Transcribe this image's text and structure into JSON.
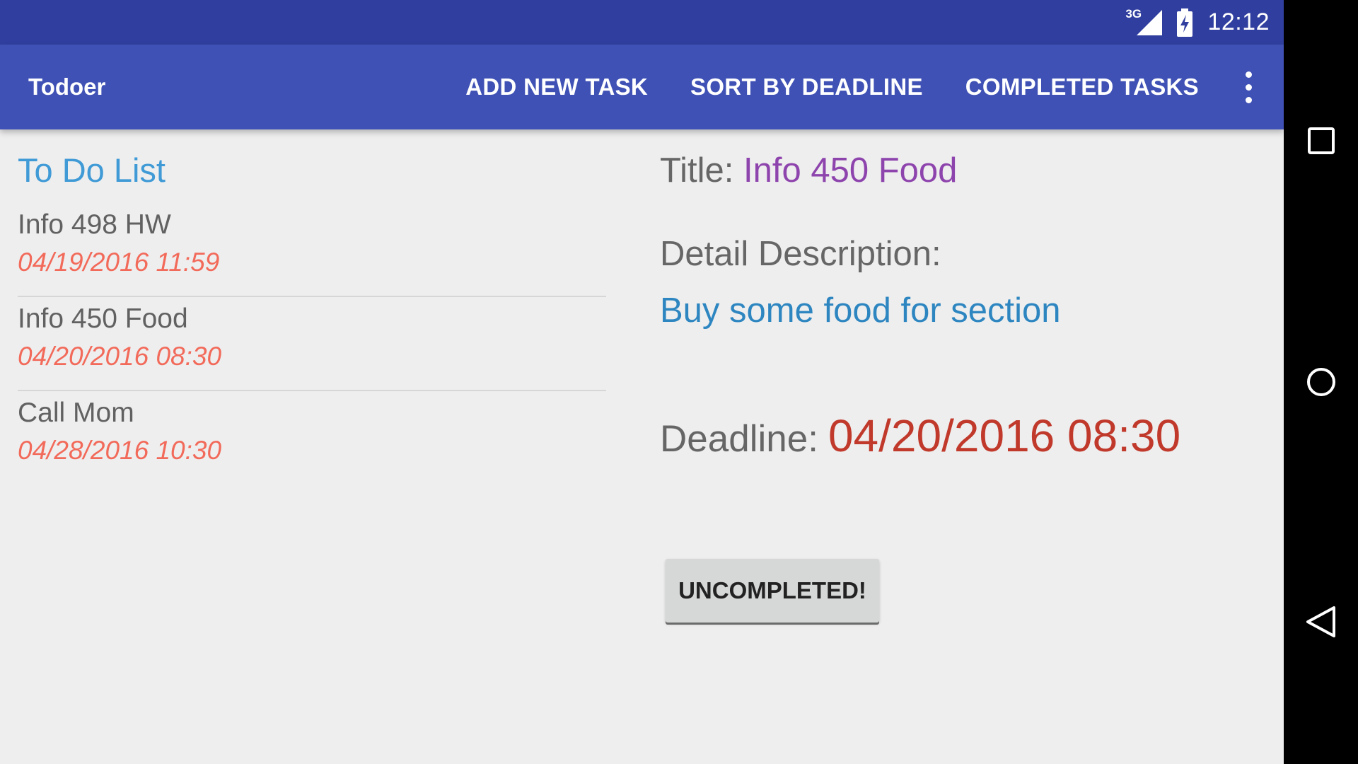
{
  "status_bar": {
    "network_label": "3G",
    "time": "12:12",
    "signal_icon": "cell-signal-icon",
    "battery_icon": "battery-charging-icon"
  },
  "app_bar": {
    "title": "Todoer",
    "actions": [
      "ADD NEW TASK",
      "SORT BY DEADLINE",
      "COMPLETED TASKS"
    ],
    "overflow_icon": "more-vert-icon"
  },
  "list": {
    "heading": "To Do List",
    "items": [
      {
        "name": "Info 498 HW",
        "date": "04/19/2016 11:59"
      },
      {
        "name": "Info 450 Food",
        "date": "04/20/2016 08:30"
      },
      {
        "name": "Call Mom",
        "date": "04/28/2016 10:30"
      }
    ]
  },
  "detail": {
    "title_label": "Title: ",
    "title_value": "Info 450 Food",
    "description_label": "Detail Description:",
    "description_value": "Buy some food for section",
    "deadline_label": "Deadline:",
    "deadline_value": "04/20/2016 08:30",
    "button_label": "UNCOMPLETED!"
  },
  "nav_bar": {
    "icons": [
      "recents-square-icon",
      "home-circle-icon",
      "back-triangle-icon"
    ]
  },
  "colors": {
    "status_bar": "#303f9f",
    "app_bar": "#3f51b5",
    "list_heading": "#3f9ad6",
    "date_text": "#f26a5a",
    "title_value": "#8e44ad",
    "description_value": "#2e86c1",
    "deadline_value": "#c0392b"
  }
}
